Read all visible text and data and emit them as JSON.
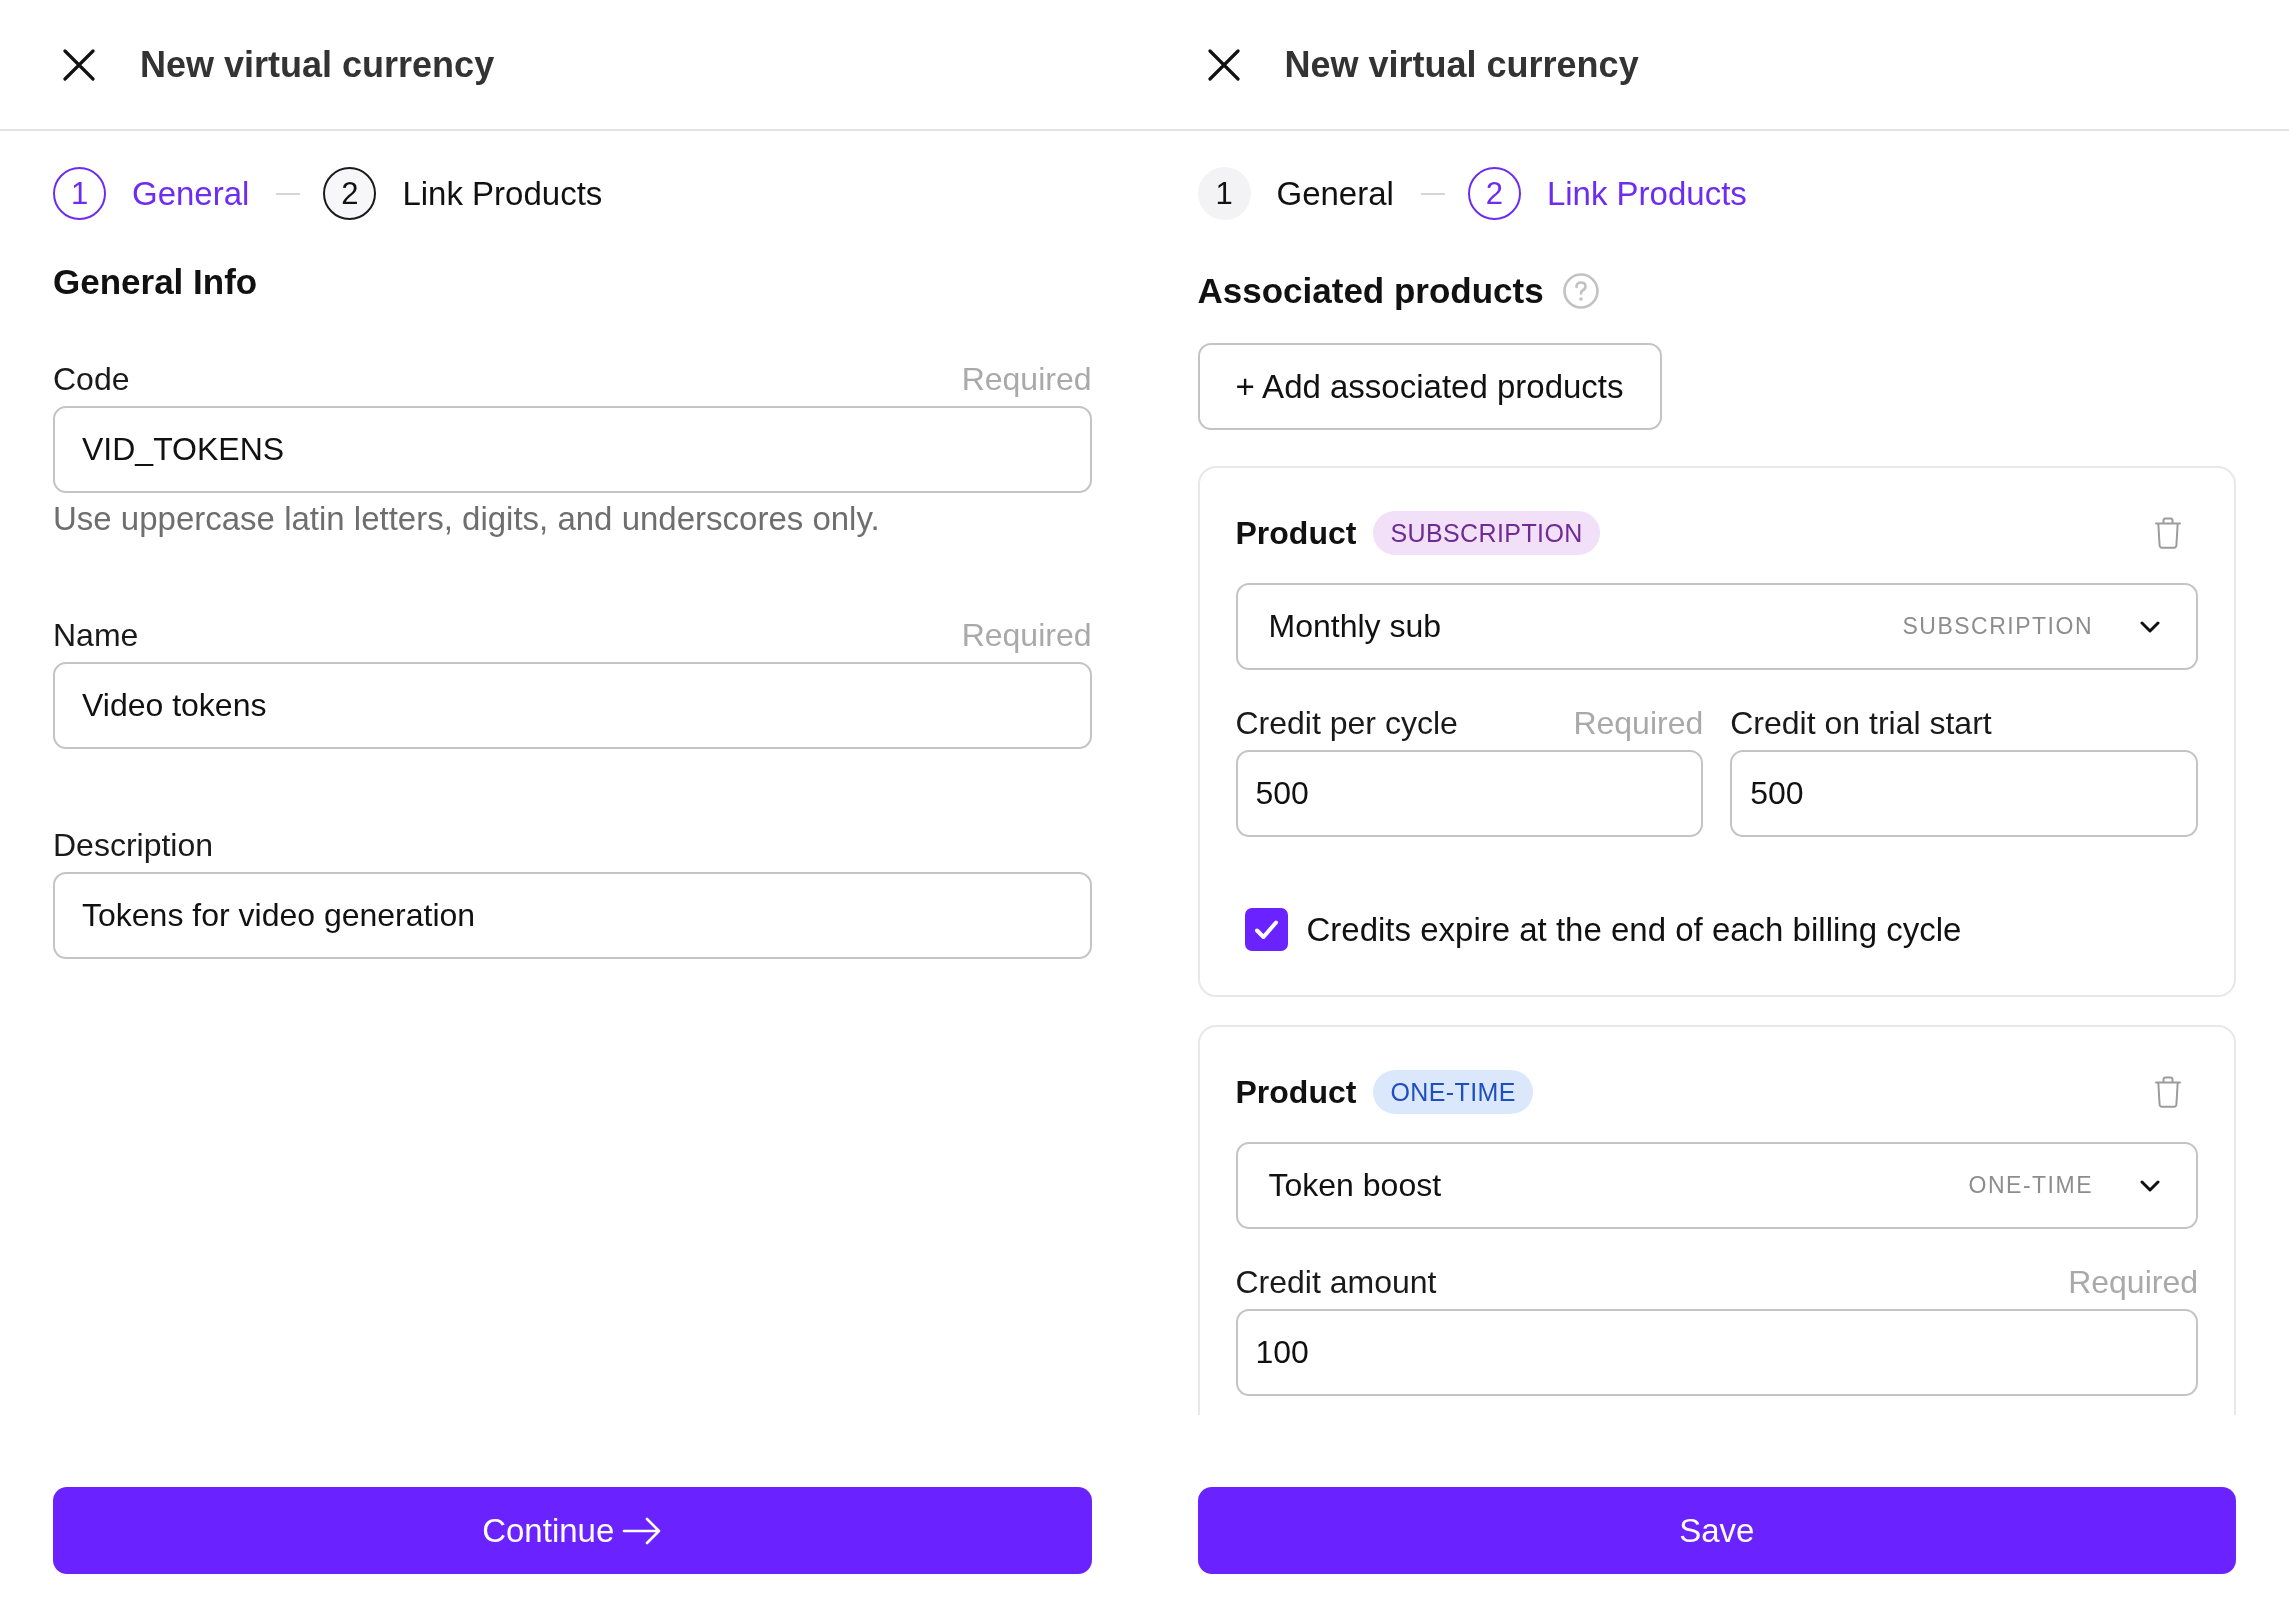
{
  "general_panel": {
    "title": "New virtual currency",
    "steps": [
      {
        "number": "1",
        "label": "General",
        "selected": true,
        "completed": false
      },
      {
        "number": "2",
        "label": "Link Products",
        "selected": false,
        "completed": false
      }
    ],
    "section_title": "General Info",
    "fields": [
      {
        "label": "Code",
        "required_note": "Required",
        "value": "VID_TOKENS",
        "hint": "Use uppercase latin letters, digits, and underscores only."
      },
      {
        "label": "Name",
        "required_note": "Required",
        "value": "Video tokens"
      },
      {
        "label": "Description",
        "value": "Tokens for video generation"
      }
    ],
    "continue_button": {
      "label": "Continue"
    }
  },
  "products_panel": {
    "title": "New virtual currency",
    "steps": [
      {
        "number": "1",
        "label": "General",
        "selected": false,
        "completed": true
      },
      {
        "number": "2",
        "label": "Link Products",
        "selected": true,
        "completed": false
      }
    ],
    "section_title": "Associated products",
    "add_button": {
      "label": "+ Add associated products"
    },
    "products": [
      {
        "kind": "subscription",
        "label": "Product",
        "badge": "SUBSCRIPTION",
        "selected_product": "Monthly sub",
        "product_type": "SUBSCRIPTION",
        "fields": [
          {
            "label": "Credit per cycle",
            "required_note": "Required",
            "value": "500"
          },
          {
            "label": "Credit on trial start",
            "value": "500"
          }
        ],
        "checkbox": {
          "label": "Credits expire at the end of each billing cycle",
          "checked": true
        }
      },
      {
        "kind": "one_time",
        "label": "Product",
        "badge": "ONE-TIME",
        "selected_product": "Token boost",
        "product_type": "ONE-TIME",
        "fields": [
          {
            "label": "Credit amount",
            "required_note": "Required",
            "value": "100"
          }
        ]
      }
    ],
    "save_button": {
      "label": "Save"
    }
  }
}
